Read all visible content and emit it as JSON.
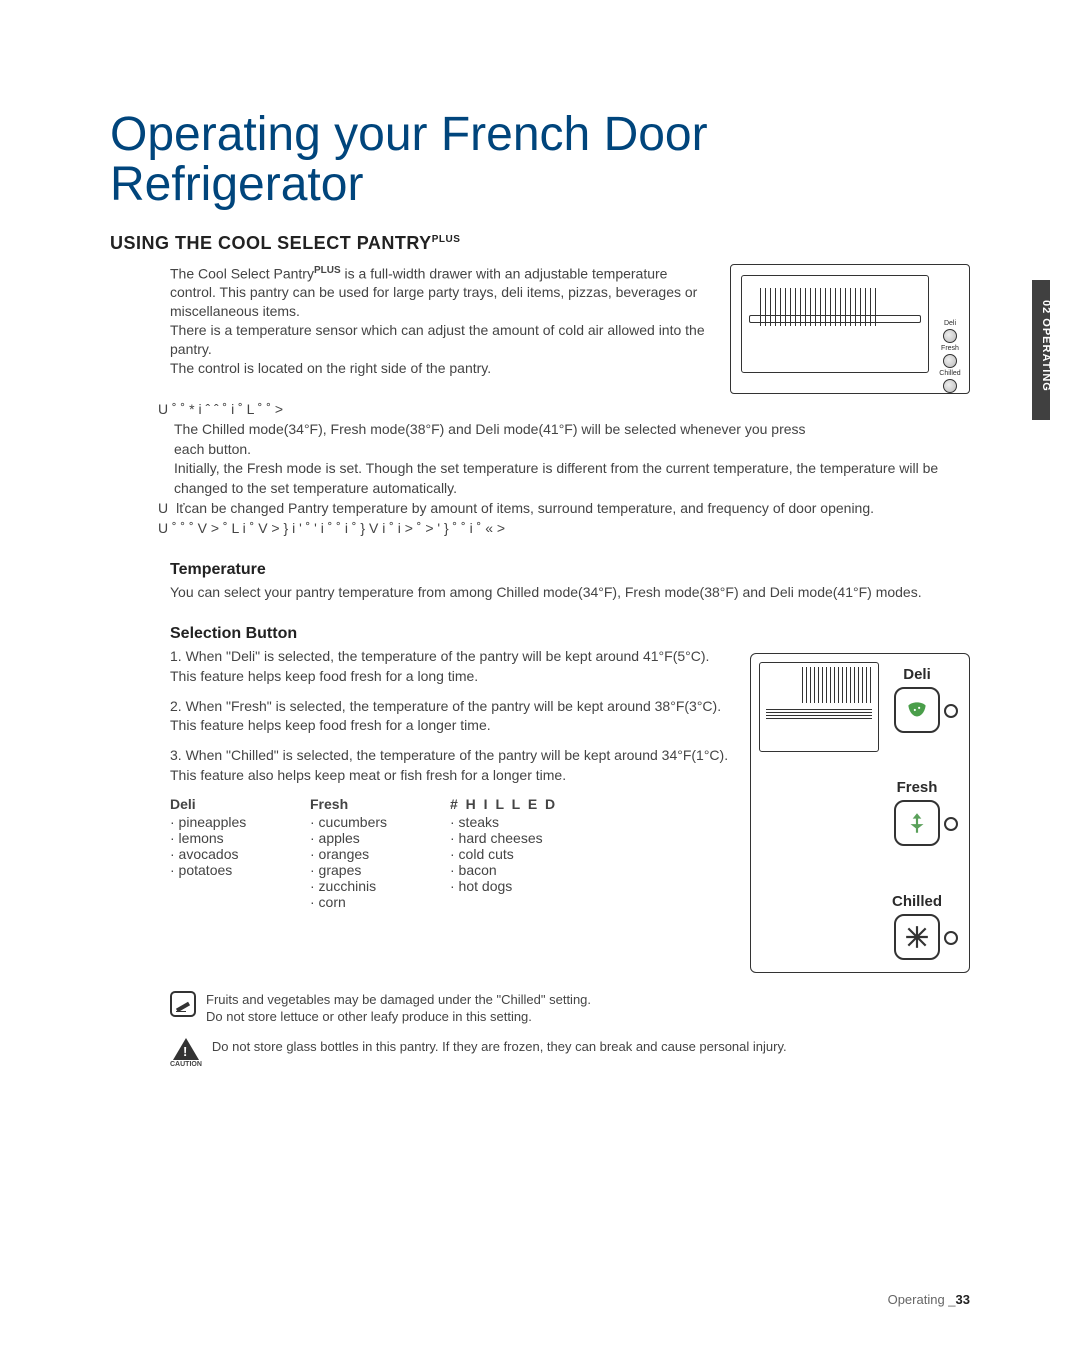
{
  "sideTab": "02 OPERATING",
  "title": "Operating your French Door Refrigerator",
  "sectionHeading": "USING THE COOL SELECT PANTRY",
  "sectionHeadingSup": "PLUS",
  "intro": {
    "p1": "The Cool Select Pantry",
    "p1sup": "PLUS",
    "p1b": " is a full-width drawer with an adjustable temperature control. This pantry can be used for large party trays, deli items, pizzas, beverages or miscellaneous items.",
    "p2": "There is a temperature sensor which can adjust the amount of cold air allowed into the pantry.",
    "p3": "The control is located on the right side of the pantry."
  },
  "miniLabels": {
    "deli": "Deli",
    "fresh": "Fresh",
    "chilled": "Chilled"
  },
  "bullets": {
    "b1line": "U ˚ ˚ * i ˆ ˆ ˚   i ˚ L        ˚      ˚  >",
    "b1a": "The Chilled mode(34°F), Fresh mode(38°F) and Deli mode(41°F) will be selected whenever you press",
    "b1b": "each button.",
    "b1c": "Initially, the Fresh mode is set. Though the set temperature is different from the current temperature, the temperature will be changed to the set temperature automatically.",
    "b2pre": "U",
    "b2": "lťcan be changed Pantry temperature by amount of items, surround temperature, and frequency of door opening.",
    "b3": "U ˚ ˚      ˚ V >  ˚ L i ˚ V  >  } i ' ˚ '  i ˚    ˚   i ˚ }    V i    ˚    i   >  ˚   > '   } ˚    ˚    i ˚ « >"
  },
  "temperature": {
    "heading": "Temperature",
    "body": "You can select your pantry temperature from among  Chilled mode(34°F), Fresh mode(38°F) and Deli mode(41°F) modes."
  },
  "selection": {
    "heading": "Selection Button",
    "items": [
      "When \"Deli\" is selected, the temperature of the pantry will be kept around 41°F(5°C). This feature helps keep food fresh for a long time.",
      "When \"Fresh\" is selected, the temperature of the pantry will be kept around 38°F(3°C). This feature helps keep food fresh for a longer time.",
      "When \"Chilled\" is selected, the temperature of the pantry will be kept around 34°F(1°C). This feature also helps keep meat or fish fresh for a longer time."
    ],
    "foods": {
      "deli": {
        "hd": "Deli",
        "items": [
          "· pineapples",
          "· lemons",
          "· avocados",
          "· potatoes"
        ]
      },
      "fresh": {
        "hd": "Fresh",
        "items": [
          "· cucumbers",
          "· apples",
          "· oranges",
          "· grapes",
          "· zucchinis",
          "· corn"
        ]
      },
      "chilled": {
        "hd": "# H I L L E D",
        "items": [
          "· steaks",
          "· hard cheeses",
          "· cold cuts",
          "· bacon",
          "· hot dogs"
        ]
      }
    },
    "panel": {
      "deli": "Deli",
      "fresh": "Fresh",
      "chilled": "Chilled"
    }
  },
  "notes": {
    "n1a": "Fruits and vegetables may be damaged under the \"Chilled\" setting.",
    "n1b": "Do not store lettuce or other leafy produce in this setting.",
    "cautionLabel": "CAUTION",
    "n2": "Do not store glass bottles in this pantry. If they are frozen, they can break and cause personal injury."
  },
  "footer": {
    "label": "Operating _",
    "page": "33"
  }
}
